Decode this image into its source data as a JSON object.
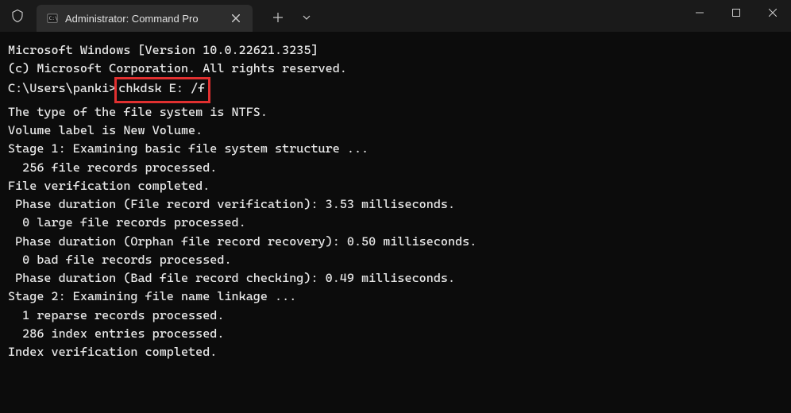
{
  "titlebar": {
    "tab_title": "Administrator: Command Pro"
  },
  "terminal": {
    "line1": "Microsoft Windows [Version 10.0.22621.3235]",
    "line2": "(c) Microsoft Corporation. All rights reserved.",
    "blank1": "",
    "prompt_prefix": "C:\\Users\\panki>",
    "command": "chkdsk E: /f",
    "line3": "The type of the file system is NTFS.",
    "line4": "Volume label is New Volume.",
    "blank2": "",
    "line5": "Stage 1: Examining basic file system structure ...",
    "line6": "  256 file records processed.",
    "line7": "File verification completed.",
    "line8": " Phase duration (File record verification): 3.53 milliseconds.",
    "line9": "  0 large file records processed.",
    "line10": " Phase duration (Orphan file record recovery): 0.50 milliseconds.",
    "line11": "  0 bad file records processed.",
    "line12": " Phase duration (Bad file record checking): 0.49 milliseconds.",
    "blank3": "",
    "line13": "Stage 2: Examining file name linkage ...",
    "line14": "  1 reparse records processed.",
    "line15": "  286 index entries processed.",
    "line16": "Index verification completed."
  }
}
